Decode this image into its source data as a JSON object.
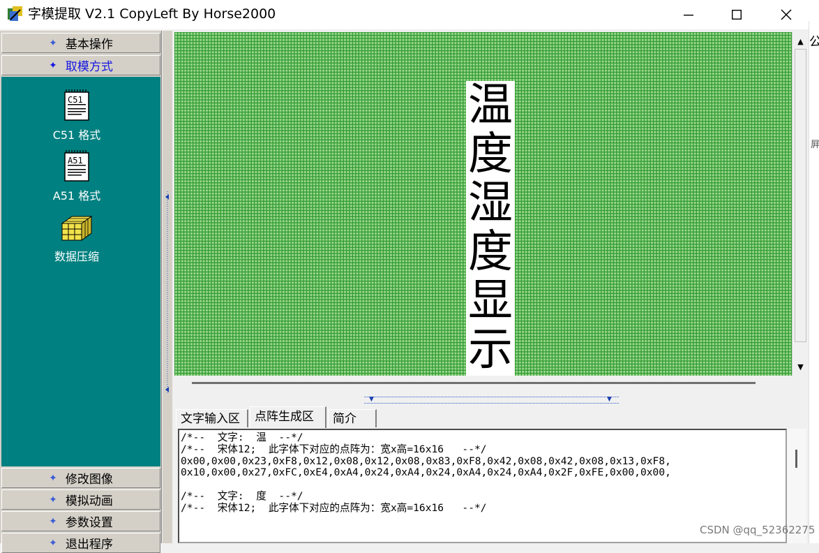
{
  "window": {
    "title": "字模提取 V2.1  CopyLeft By Horse2000",
    "minimize_glyph": "—",
    "maximize_glyph": "☐",
    "close_glyph": "✕"
  },
  "sidebar": {
    "top_categories": [
      {
        "label": "基本操作",
        "active": false
      },
      {
        "label": "取模方式",
        "active": true
      }
    ],
    "tools": [
      {
        "label": "C51 格式",
        "icon": "c51-document-icon",
        "icon_text": "C51"
      },
      {
        "label": "A51 格式",
        "icon": "a51-document-icon",
        "icon_text": "A51"
      },
      {
        "label": "数据压缩",
        "icon": "compress-cube-icon"
      }
    ],
    "bottom_categories": [
      {
        "label": "修改图像"
      },
      {
        "label": "模拟动画"
      },
      {
        "label": "参数设置"
      },
      {
        "label": "退出程序"
      }
    ],
    "bullet_glyph": "✦"
  },
  "canvas": {
    "grid_color": "#34a234",
    "glyphs": [
      "温",
      "度",
      "湿",
      "度",
      "显",
      "示"
    ]
  },
  "scroll": {
    "up_glyph": "▲",
    "down_glyph": "▼"
  },
  "tabs": [
    {
      "label": "文字输入区",
      "active": false
    },
    {
      "label": "点阵生成区",
      "active": true
    },
    {
      "label": "简介",
      "active": false
    }
  ],
  "output": {
    "lines": [
      "/*--  文字:  温  --*/",
      "/*--  宋体12;  此字体下对应的点阵为：宽x高=16x16   --*/",
      "0x00,0x00,0x23,0xF8,0x12,0x08,0x12,0x08,0x83,0xF8,0x42,0x08,0x42,0x08,0x13,0xF8,",
      "0x10,0x00,0x27,0xFC,0xE4,0xA4,0x24,0xA4,0x24,0xA4,0x24,0xA4,0x2F,0xFE,0x00,0x00,",
      "",
      "/*--  文字:  度  --*/",
      "/*--  宋体12;  此字体下对应的点阵为：宽x高=16x16   --*/"
    ]
  },
  "edge": {
    "glyph_top": "公",
    "glyph_mid": "屛"
  },
  "watermark": "CSDN @qq_52362275"
}
